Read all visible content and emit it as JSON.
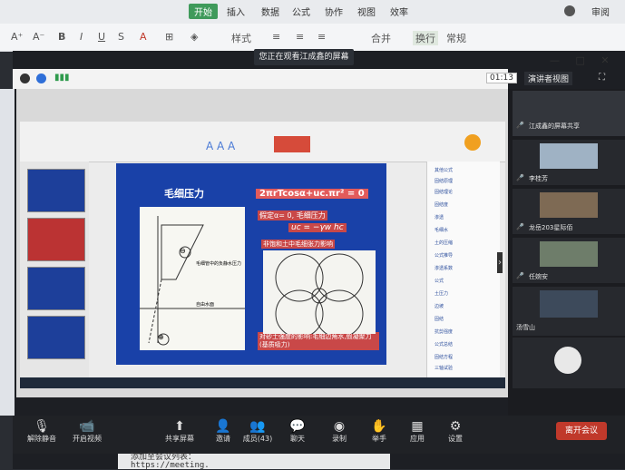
{
  "ribbon": {
    "tabs": [
      "开始",
      "插入",
      "数据",
      "公式",
      "协作",
      "视图",
      "效率"
    ],
    "active_tab": "开始",
    "right_label": "审阅",
    "tools": [
      "样式",
      "合并",
      "换行",
      "常规"
    ]
  },
  "meeting": {
    "share_banner": "您正在观看江成鑫的屏幕",
    "timer": "01:13",
    "view_mode": "演讲者视图",
    "shared_slide": {
      "title": "毛细压力",
      "formula": "2πrTcosα+uc.πr² = 0",
      "assume": "假定α= 0, 毛细压力",
      "eq": "uc = −γw hc",
      "bullet": "非饱和土中毛细张力影响",
      "caption": "对砂土强度的影响:毛细边角水,假凝聚力(基质吸力)",
      "diagram_label1": "毛细管中的负静水压力",
      "diagram_label2": "自由水面",
      "minus": "⊖",
      "plus": "⊕"
    },
    "right_panel_items": [
      "其他公式",
      "固结原理",
      "固结理论",
      "固结度",
      "渗透",
      "毛细水",
      "土的压缩",
      "公式推导",
      "渗透系数",
      "公式",
      "土压力",
      "边坡",
      "固结",
      "抗剪强度",
      "公式总结",
      "固结方程",
      "三轴试验"
    ],
    "participants": [
      {
        "name": "江成鑫的屏幕共享",
        "mic": "🎤"
      },
      {
        "name": "李桂芳",
        "mic": "🎤"
      },
      {
        "name": "龙岳203星际佰",
        "mic": "🎤"
      },
      {
        "name": "任婉安",
        "mic": "🎤"
      },
      {
        "name": "汤雪山",
        "mic": ""
      },
      {
        "name": "",
        "mic": ""
      }
    ],
    "toolbar": {
      "unmute": "解除静音",
      "video": "开启视频",
      "share": "共享屏幕",
      "invite": "邀请",
      "members": "成员(43)",
      "chat": "聊天",
      "record": "录制",
      "raise": "举手",
      "apps": "应用",
      "settings": "设置",
      "leave": "离开会议"
    },
    "bottom_text1": "添加至会议列表：",
    "bottom_text2": "https://meeting."
  },
  "colors": {
    "accent": "#3f9a5b",
    "leave": "#c0392b",
    "slide_bg": "#1941a8"
  }
}
